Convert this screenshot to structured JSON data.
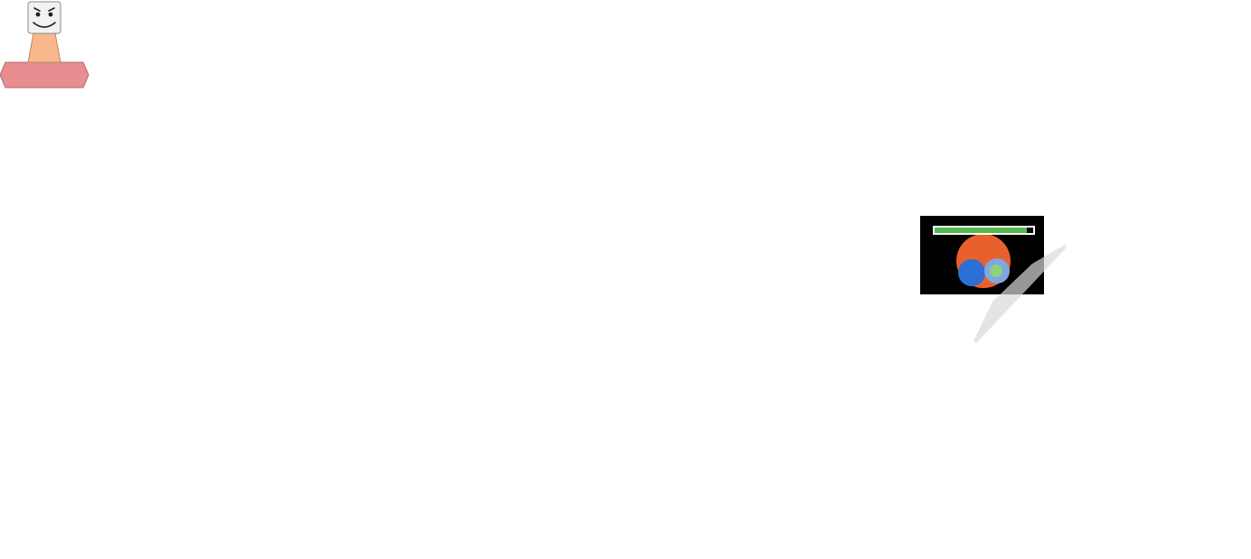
{
  "scene": {
    "background_color": "#ffffff"
  },
  "player": {
    "icon": "smiley-head-on-pedestal-icon",
    "head_color": "#f2f2f2",
    "neck_color": "#f8b88b",
    "base_color": "#e88d90"
  },
  "enemy": {
    "icon": "blob-monster-icon",
    "health_fraction": 0.94,
    "health_color": "#55b94e",
    "body_color": "#e8612c",
    "shield_color": "#2c6fd6",
    "core_color": "#7fa7e0",
    "core_center_color": "#8ed17a"
  },
  "beam": {
    "icon": "light-beam-icon",
    "color": "#d9d9d9"
  }
}
